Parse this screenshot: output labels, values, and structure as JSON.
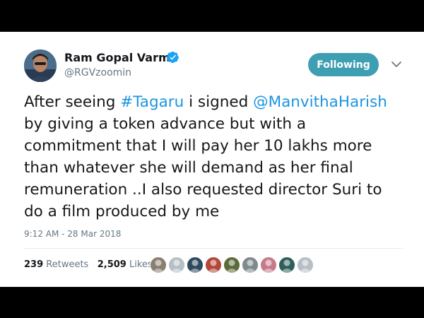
{
  "user": {
    "display_name": "Ram Gopal Varma",
    "handle": "@RGVzoomin",
    "verified": true
  },
  "follow_button": {
    "label": "Following",
    "color": "#3e9fb2"
  },
  "tweet": {
    "segments": [
      {
        "text": "After seeing ",
        "type": "plain"
      },
      {
        "text": "#Tagaru",
        "type": "link"
      },
      {
        "text": " i signed ",
        "type": "plain"
      },
      {
        "text": "@ManvithaHarish",
        "type": "link"
      },
      {
        "text": " by giving a token advance but with a commitment that I will pay her 10 lakhs more than whatever she will demand as her final remuneration ..I also requested director Suri to do a film produced by me",
        "type": "plain"
      }
    ],
    "timestamp": "9:12 AM - 28 Mar 2018"
  },
  "stats": {
    "retweets_count": "239",
    "retweets_label": "Retweets",
    "likes_count": "2,509",
    "likes_label": "Likes"
  },
  "likers": [
    {
      "name": "liker-avatar-1",
      "color": "#8a7f70"
    },
    {
      "name": "liker-avatar-2",
      "color": "#b7bfc6"
    },
    {
      "name": "liker-avatar-3",
      "color": "#2e4a5e"
    },
    {
      "name": "liker-avatar-4",
      "color": "#b3473a"
    },
    {
      "name": "liker-avatar-5",
      "color": "#5c6b3a"
    },
    {
      "name": "liker-avatar-6",
      "color": "#7e8a8c"
    },
    {
      "name": "liker-avatar-7",
      "color": "#c77a8a"
    },
    {
      "name": "liker-avatar-8",
      "color": "#2f5f5a"
    },
    {
      "name": "liker-avatar-9",
      "color": "#b7bfc6"
    }
  ],
  "colors": {
    "link": "#1b95e0",
    "verified": "#1da1f2",
    "text": "#14171a",
    "secondary": "#657786"
  }
}
